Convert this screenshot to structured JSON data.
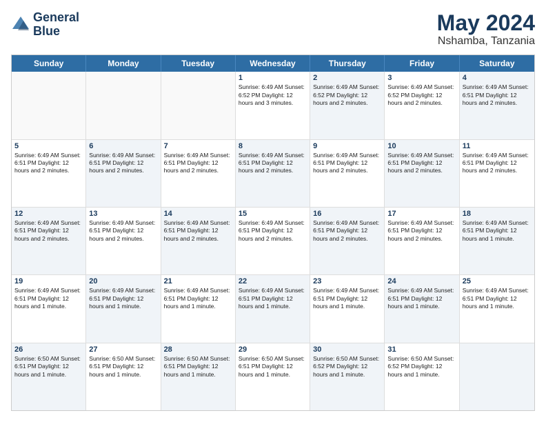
{
  "header": {
    "logo_line1": "General",
    "logo_line2": "Blue",
    "month_year": "May 2024",
    "location": "Nshamba, Tanzania"
  },
  "days_of_week": [
    "Sunday",
    "Monday",
    "Tuesday",
    "Wednesday",
    "Thursday",
    "Friday",
    "Saturday"
  ],
  "weeks": [
    [
      {
        "day": "",
        "info": "",
        "shaded": false
      },
      {
        "day": "",
        "info": "",
        "shaded": false
      },
      {
        "day": "",
        "info": "",
        "shaded": false
      },
      {
        "day": "1",
        "info": "Sunrise: 6:49 AM\nSunset: 6:52 PM\nDaylight: 12 hours\nand 3 minutes.",
        "shaded": false
      },
      {
        "day": "2",
        "info": "Sunrise: 6:49 AM\nSunset: 6:52 PM\nDaylight: 12 hours\nand 2 minutes.",
        "shaded": true
      },
      {
        "day": "3",
        "info": "Sunrise: 6:49 AM\nSunset: 6:52 PM\nDaylight: 12 hours\nand 2 minutes.",
        "shaded": false
      },
      {
        "day": "4",
        "info": "Sunrise: 6:49 AM\nSunset: 6:51 PM\nDaylight: 12 hours\nand 2 minutes.",
        "shaded": true
      }
    ],
    [
      {
        "day": "5",
        "info": "Sunrise: 6:49 AM\nSunset: 6:51 PM\nDaylight: 12 hours\nand 2 minutes.",
        "shaded": false
      },
      {
        "day": "6",
        "info": "Sunrise: 6:49 AM\nSunset: 6:51 PM\nDaylight: 12 hours\nand 2 minutes.",
        "shaded": true
      },
      {
        "day": "7",
        "info": "Sunrise: 6:49 AM\nSunset: 6:51 PM\nDaylight: 12 hours\nand 2 minutes.",
        "shaded": false
      },
      {
        "day": "8",
        "info": "Sunrise: 6:49 AM\nSunset: 6:51 PM\nDaylight: 12 hours\nand 2 minutes.",
        "shaded": true
      },
      {
        "day": "9",
        "info": "Sunrise: 6:49 AM\nSunset: 6:51 PM\nDaylight: 12 hours\nand 2 minutes.",
        "shaded": false
      },
      {
        "day": "10",
        "info": "Sunrise: 6:49 AM\nSunset: 6:51 PM\nDaylight: 12 hours\nand 2 minutes.",
        "shaded": true
      },
      {
        "day": "11",
        "info": "Sunrise: 6:49 AM\nSunset: 6:51 PM\nDaylight: 12 hours\nand 2 minutes.",
        "shaded": false
      }
    ],
    [
      {
        "day": "12",
        "info": "Sunrise: 6:49 AM\nSunset: 6:51 PM\nDaylight: 12 hours\nand 2 minutes.",
        "shaded": true
      },
      {
        "day": "13",
        "info": "Sunrise: 6:49 AM\nSunset: 6:51 PM\nDaylight: 12 hours\nand 2 minutes.",
        "shaded": false
      },
      {
        "day": "14",
        "info": "Sunrise: 6:49 AM\nSunset: 6:51 PM\nDaylight: 12 hours\nand 2 minutes.",
        "shaded": true
      },
      {
        "day": "15",
        "info": "Sunrise: 6:49 AM\nSunset: 6:51 PM\nDaylight: 12 hours\nand 2 minutes.",
        "shaded": false
      },
      {
        "day": "16",
        "info": "Sunrise: 6:49 AM\nSunset: 6:51 PM\nDaylight: 12 hours\nand 2 minutes.",
        "shaded": true
      },
      {
        "day": "17",
        "info": "Sunrise: 6:49 AM\nSunset: 6:51 PM\nDaylight: 12 hours\nand 2 minutes.",
        "shaded": false
      },
      {
        "day": "18",
        "info": "Sunrise: 6:49 AM\nSunset: 6:51 PM\nDaylight: 12 hours\nand 1 minute.",
        "shaded": true
      }
    ],
    [
      {
        "day": "19",
        "info": "Sunrise: 6:49 AM\nSunset: 6:51 PM\nDaylight: 12 hours\nand 1 minute.",
        "shaded": false
      },
      {
        "day": "20",
        "info": "Sunrise: 6:49 AM\nSunset: 6:51 PM\nDaylight: 12 hours\nand 1 minute.",
        "shaded": true
      },
      {
        "day": "21",
        "info": "Sunrise: 6:49 AM\nSunset: 6:51 PM\nDaylight: 12 hours\nand 1 minute.",
        "shaded": false
      },
      {
        "day": "22",
        "info": "Sunrise: 6:49 AM\nSunset: 6:51 PM\nDaylight: 12 hours\nand 1 minute.",
        "shaded": true
      },
      {
        "day": "23",
        "info": "Sunrise: 6:49 AM\nSunset: 6:51 PM\nDaylight: 12 hours\nand 1 minute.",
        "shaded": false
      },
      {
        "day": "24",
        "info": "Sunrise: 6:49 AM\nSunset: 6:51 PM\nDaylight: 12 hours\nand 1 minute.",
        "shaded": true
      },
      {
        "day": "25",
        "info": "Sunrise: 6:49 AM\nSunset: 6:51 PM\nDaylight: 12 hours\nand 1 minute.",
        "shaded": false
      }
    ],
    [
      {
        "day": "26",
        "info": "Sunrise: 6:50 AM\nSunset: 6:51 PM\nDaylight: 12 hours\nand 1 minute.",
        "shaded": true
      },
      {
        "day": "27",
        "info": "Sunrise: 6:50 AM\nSunset: 6:51 PM\nDaylight: 12 hours\nand 1 minute.",
        "shaded": false
      },
      {
        "day": "28",
        "info": "Sunrise: 6:50 AM\nSunset: 6:51 PM\nDaylight: 12 hours\nand 1 minute.",
        "shaded": true
      },
      {
        "day": "29",
        "info": "Sunrise: 6:50 AM\nSunset: 6:51 PM\nDaylight: 12 hours\nand 1 minute.",
        "shaded": false
      },
      {
        "day": "30",
        "info": "Sunrise: 6:50 AM\nSunset: 6:52 PM\nDaylight: 12 hours\nand 1 minute.",
        "shaded": true
      },
      {
        "day": "31",
        "info": "Sunrise: 6:50 AM\nSunset: 6:52 PM\nDaylight: 12 hours\nand 1 minute.",
        "shaded": false
      },
      {
        "day": "",
        "info": "",
        "shaded": true
      }
    ]
  ]
}
